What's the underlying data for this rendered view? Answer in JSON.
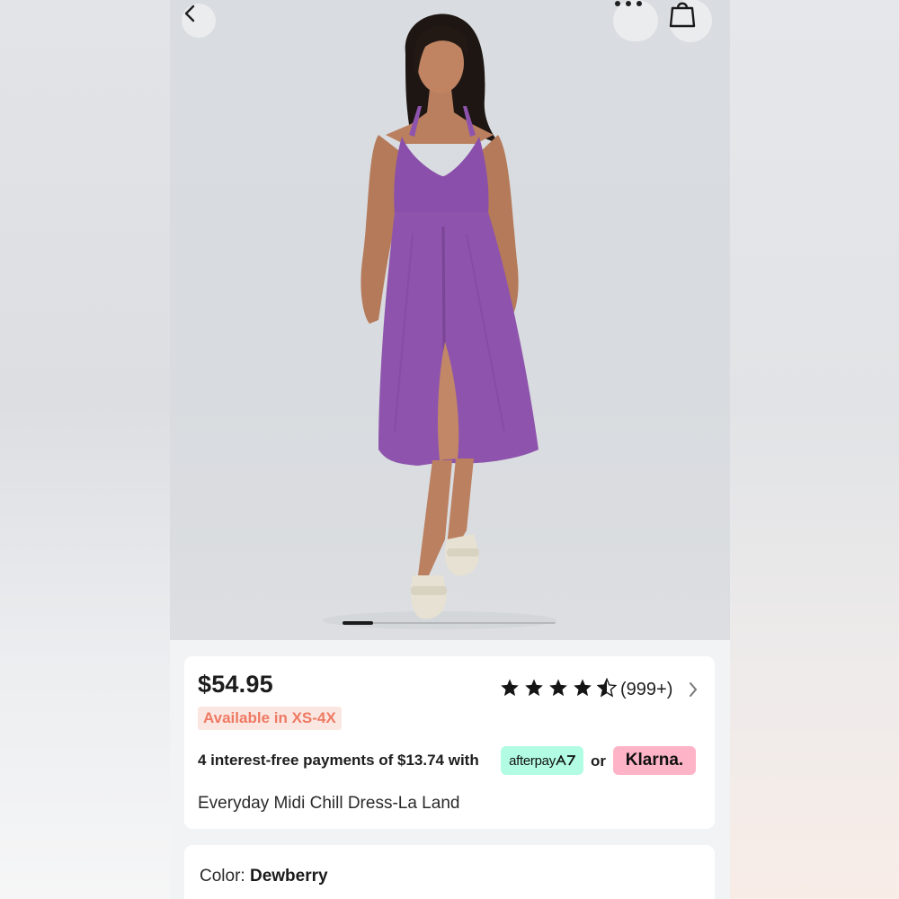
{
  "header": {
    "back_icon": "chevron-left-icon",
    "more_icon": "more-horizontal-icon",
    "bag_icon": "shopping-bag-icon"
  },
  "gallery": {
    "image": "product photo: model in purple midi dress",
    "page_index": 1,
    "page_fraction": 0.14
  },
  "product": {
    "price": "$54.95",
    "availability": "Available in XS-4X",
    "rating": 4.5,
    "reviews_count": "(999+)",
    "payments_text": "4 interest-free payments of $13.74 with",
    "afterpay_label": "afterpay",
    "or_text": "or",
    "klarna_label": "Klarna.",
    "title": "Everyday Midi Chill Dress-La Land"
  },
  "color_section": {
    "label": "Color: ",
    "value": "Dewberry"
  },
  "colors": {
    "dress": "#8e54ad",
    "afterpay_bg": "#b2fce4",
    "klarna_bg": "#ffb3c7",
    "availability_text": "#ee7a63"
  }
}
